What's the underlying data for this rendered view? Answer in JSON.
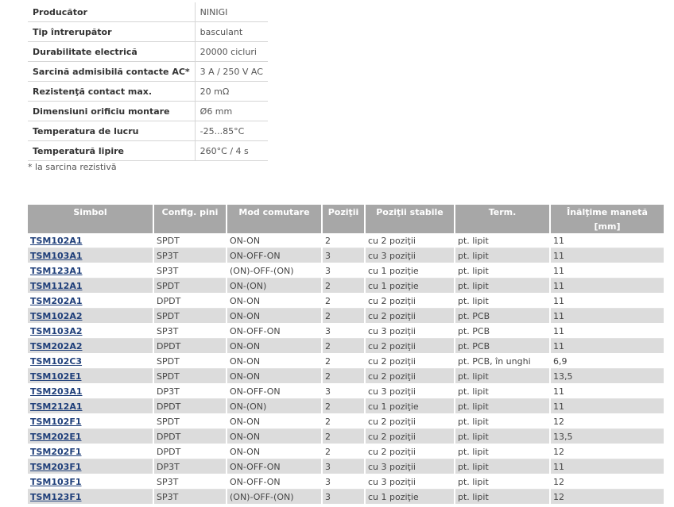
{
  "specs": [
    {
      "label": "Producător",
      "value": "NINIGI"
    },
    {
      "label": "Tip întrerupător",
      "value": "basculant"
    },
    {
      "label": "Durabilitate electrică",
      "value": "20000 cicluri"
    },
    {
      "label": "Sarcină admisibilă contacte AC*",
      "value": "3 A / 250 V AC"
    },
    {
      "label": "Rezistenţă contact max.",
      "value": "20 mΩ"
    },
    {
      "label": "Dimensiuni orificiu montare",
      "value": "Ø6 mm"
    },
    {
      "label": "Temperatura de lucru",
      "value": "-25...85°C"
    },
    {
      "label": "Temperatură lipire",
      "value": "260°C / 4 s"
    }
  ],
  "spec_note": "* la sarcina rezistivă",
  "table": {
    "headers": [
      "Simbol",
      "Config. pini",
      "Mod comutare",
      "Poziţii",
      "Poziţii stabile",
      "Term.",
      "Înălţime manetă"
    ],
    "unit": "[mm]",
    "rows": [
      [
        "TSM102A1",
        "SPDT",
        "ON-ON",
        "2",
        "cu 2 poziţii",
        "pt. lipit",
        "11"
      ],
      [
        "TSM103A1",
        "SP3T",
        "ON-OFF-ON",
        "3",
        "cu 3 poziţii",
        "pt. lipit",
        "11"
      ],
      [
        "TSM123A1",
        "SP3T",
        "(ON)-OFF-(ON)",
        "3",
        "cu 1 poziţie",
        "pt. lipit",
        "11"
      ],
      [
        "TSM112A1",
        "SPDT",
        "ON-(ON)",
        "2",
        "cu 1 poziţie",
        "pt. lipit",
        "11"
      ],
      [
        "TSM202A1",
        "DPDT",
        "ON-ON",
        "2",
        "cu 2 poziţii",
        "pt. lipit",
        "11"
      ],
      [
        "TSM102A2",
        "SPDT",
        "ON-ON",
        "2",
        "cu 2 poziţii",
        "pt. PCB",
        "11"
      ],
      [
        "TSM103A2",
        "SP3T",
        "ON-OFF-ON",
        "3",
        "cu 3 poziţii",
        "pt. PCB",
        "11"
      ],
      [
        "TSM202A2",
        "DPDT",
        "ON-ON",
        "2",
        "cu 2 poziţii",
        "pt. PCB",
        "11"
      ],
      [
        "TSM102C3",
        "SPDT",
        "ON-ON",
        "2",
        "cu 2 poziţii",
        "pt. PCB, în unghi",
        "6,9"
      ],
      [
        "TSM102E1",
        "SPDT",
        "ON-ON",
        "2",
        "cu 2 poziţii",
        "pt. lipit",
        "13,5"
      ],
      [
        "TSM203A1",
        "DP3T",
        "ON-OFF-ON",
        "3",
        "cu 3 poziţii",
        "pt. lipit",
        "11"
      ],
      [
        "TSM212A1",
        "DPDT",
        "ON-(ON)",
        "2",
        "cu 1 poziţie",
        "pt. lipit",
        "11"
      ],
      [
        "TSM102F1",
        "SPDT",
        "ON-ON",
        "2",
        "cu 2 poziţii",
        "pt. lipit",
        "12"
      ],
      [
        "TSM202E1",
        "DPDT",
        "ON-ON",
        "2",
        "cu 2 poziţii",
        "pt. lipit",
        "13,5"
      ],
      [
        "TSM202F1",
        "DPDT",
        "ON-ON",
        "2",
        "cu 2 poziţii",
        "pt. lipit",
        "12"
      ],
      [
        "TSM203F1",
        "DP3T",
        "ON-OFF-ON",
        "3",
        "cu 3 poziţii",
        "pt. lipit",
        "11"
      ],
      [
        "TSM103F1",
        "SP3T",
        "ON-OFF-ON",
        "3",
        "cu 3 poziţii",
        "pt. lipit",
        "12"
      ],
      [
        "TSM123F1",
        "SP3T",
        "(ON)-OFF-(ON)",
        "3",
        "cu 1 poziţie",
        "pt. lipit",
        "12"
      ]
    ]
  }
}
